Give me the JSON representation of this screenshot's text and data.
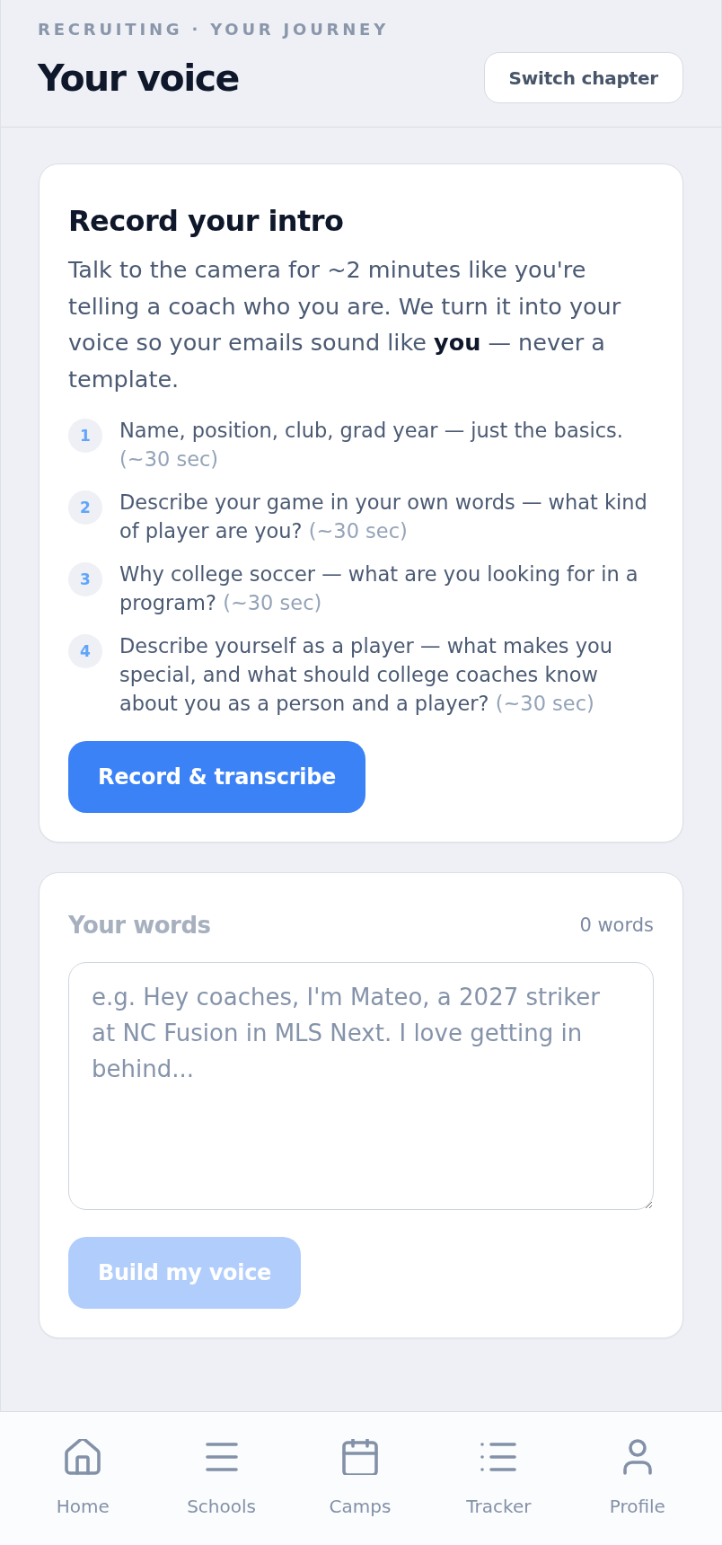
{
  "header": {
    "eyebrow": "RECRUITING · YOUR JOURNEY",
    "title": "Your voice",
    "action": "Switch chapter"
  },
  "record_card": {
    "title": "Record your intro",
    "intro": "Talk to the camera for ~2 minutes like you're telling a coach who you are. We turn it into your voice so your emails sound like **you** — never a template.",
    "steps": [
      {
        "number": "1",
        "text": "Name, position, club, grad year — just the basics.",
        "duration": "(~30 sec)"
      },
      {
        "number": "2",
        "text": "Describe your game in your own words — what kind of player are you?",
        "duration": "(~30 sec)"
      },
      {
        "number": "3",
        "text": "Why college soccer — what are you looking for in a program?",
        "duration": "(~30 sec)"
      },
      {
        "number": "4",
        "text": "Describe yourself as a player — what makes you special, and what should college coaches know about you as a person and a player?",
        "duration": "(~30 sec)"
      }
    ],
    "button": {
      "label": "Record & transcribe",
      "disabled": false
    }
  },
  "words_card": {
    "title": "Your words",
    "count": "0 words",
    "textarea": {
      "placeholder": "e.g. Hey coaches, I'm Mateo, a 2027 striker at NC Fusion in MLS Next. I love getting in behind..."
    },
    "button": {
      "label": "Build my voice",
      "disabled": true
    }
  },
  "nav": [
    {
      "label": "Home",
      "selected": false
    },
    {
      "label": "Schools",
      "selected": false
    },
    {
      "label": "Camps",
      "selected": false
    },
    {
      "label": "Tracker",
      "selected": false
    },
    {
      "label": "Profile",
      "selected": false
    }
  ]
}
